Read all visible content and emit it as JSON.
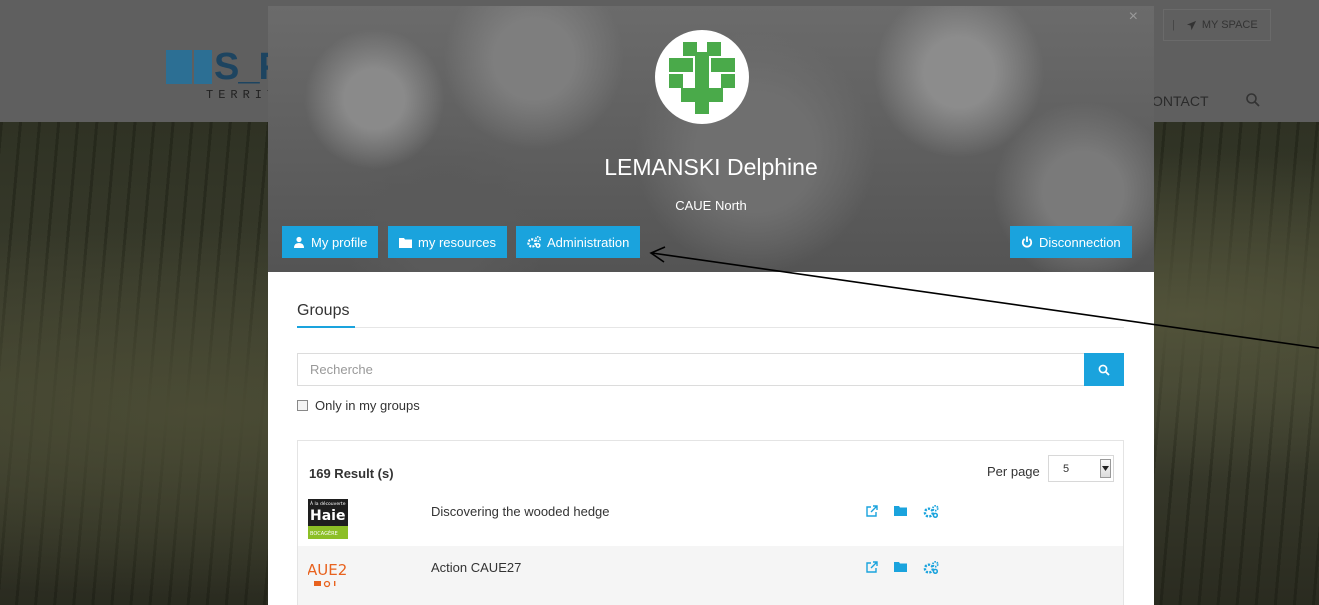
{
  "background": {
    "logo_text": "S_PA",
    "logo_sub": "TERRIT",
    "my_space_label": "MY SPACE",
    "nav_contact": "ONTACT"
  },
  "modal": {
    "user_name": "LEMANSKI Delphine",
    "user_org": "CAUE North",
    "buttons": {
      "my_profile": "My profile",
      "my_resources": "my resources",
      "administration": "Administration",
      "disconnection": "Disconnection"
    },
    "groups": {
      "title": "Groups",
      "search_placeholder": "Recherche",
      "only_my_groups": "Only in my groups",
      "result_count": "169 Result (s)",
      "per_page_label": "Per page",
      "per_page_value": "5",
      "rows": [
        {
          "title": "Discovering the wooded hedge",
          "thumb_line1": "À la découverte",
          "thumb_line2": "Haie",
          "thumb_line3": "BOCAGÈRE"
        },
        {
          "title": "Action CAUE27",
          "thumb_line1": "AUE2"
        }
      ]
    }
  },
  "colors": {
    "accent": "#1aa3dd",
    "avatar_green": "#4aaa4a",
    "hedge_green": "#8cbf26"
  }
}
